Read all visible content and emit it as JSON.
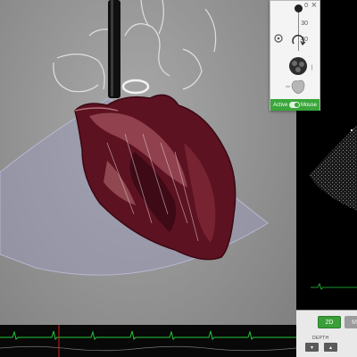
{
  "app": {
    "colors": {
      "accent_green": "#3aa63a",
      "ecg_trace": "#22c93a",
      "background_gray": "#959595",
      "heart_dark": "#5a1020",
      "sector_fill": "#9a9ab8"
    }
  },
  "control_popup": {
    "close_label": "×",
    "scale": [
      "0",
      "30",
      "40"
    ],
    "icons": [
      "circle-icon",
      "rotate-icon",
      "heart-top-icon",
      "heart-side-icon"
    ],
    "pointer_label": "Active",
    "mouse_label": "Mouse"
  },
  "bottom_panel": {
    "mode_2d_label": "2D",
    "mode_other_label": "M",
    "depth_label": "DEPTH",
    "depth_down_label": "▾",
    "depth_up_label": "▴"
  },
  "ecg": {
    "cursor_color": "#d02020"
  }
}
